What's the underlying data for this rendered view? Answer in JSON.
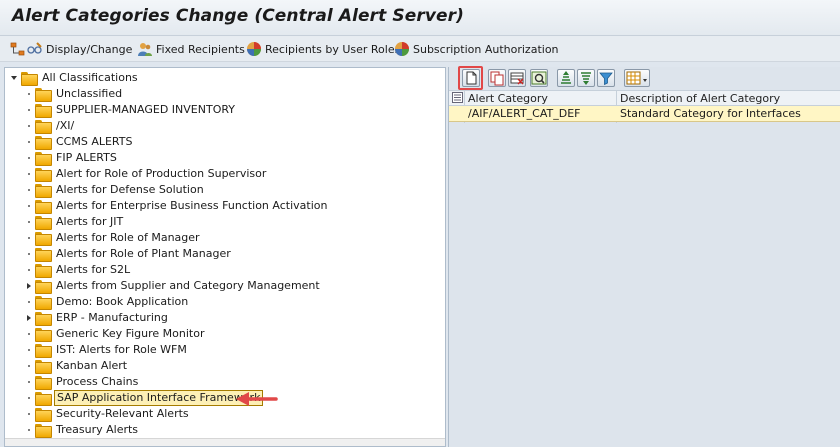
{
  "window": {
    "title": "Alert Categories Change (Central Alert Server)"
  },
  "toolbar": {
    "display_change": "Display/Change",
    "fixed_recipients": "Fixed Recipients",
    "recipients_by_user_roles": "Recipients by User Roles",
    "subscription_authorization": "Subscription Authorization"
  },
  "tree": {
    "root": "All Classifications",
    "items": [
      {
        "label": "Unclassified",
        "expandable": false
      },
      {
        "label": "SUPPLIER-MANAGED INVENTORY",
        "expandable": false
      },
      {
        "label": "/XI/",
        "expandable": false
      },
      {
        "label": "CCMS ALERTS",
        "expandable": false
      },
      {
        "label": "FIP ALERTS",
        "expandable": false
      },
      {
        "label": "Alert for Role of Production Supervisor",
        "expandable": false
      },
      {
        "label": "Alerts for Defense Solution",
        "expandable": false
      },
      {
        "label": "Alerts for Enterprise Business Function Activation",
        "expandable": false
      },
      {
        "label": "Alerts for JIT",
        "expandable": false
      },
      {
        "label": "Alerts for Role of Manager",
        "expandable": false
      },
      {
        "label": "Alerts for Role of Plant Manager",
        "expandable": false
      },
      {
        "label": "Alerts for S2L",
        "expandable": false
      },
      {
        "label": "Alerts from Supplier and Category Management",
        "expandable": true
      },
      {
        "label": "Demo: Book Application",
        "expandable": false
      },
      {
        "label": "ERP - Manufacturing",
        "expandable": true
      },
      {
        "label": "Generic Key Figure Monitor",
        "expandable": false
      },
      {
        "label": "IST: Alerts for Role WFM",
        "expandable": false
      },
      {
        "label": "Kanban Alert",
        "expandable": false
      },
      {
        "label": "Process Chains",
        "expandable": false
      },
      {
        "label": "SAP Application Interface Framework",
        "expandable": false,
        "selected": true
      },
      {
        "label": "Security-Relevant Alerts",
        "expandable": false
      },
      {
        "label": "Treasury Alerts",
        "expandable": false
      }
    ]
  },
  "grid": {
    "columns": [
      "Alert Category",
      "Description of Alert Category"
    ],
    "rows": [
      {
        "category": "/AIF/ALERT_CAT_DEF",
        "description": "Standard Category for Interfaces"
      }
    ]
  },
  "colors": {
    "highlight_red": "#e14848",
    "selected_bg": "#fdf0b6",
    "folder": "#f0a800"
  }
}
